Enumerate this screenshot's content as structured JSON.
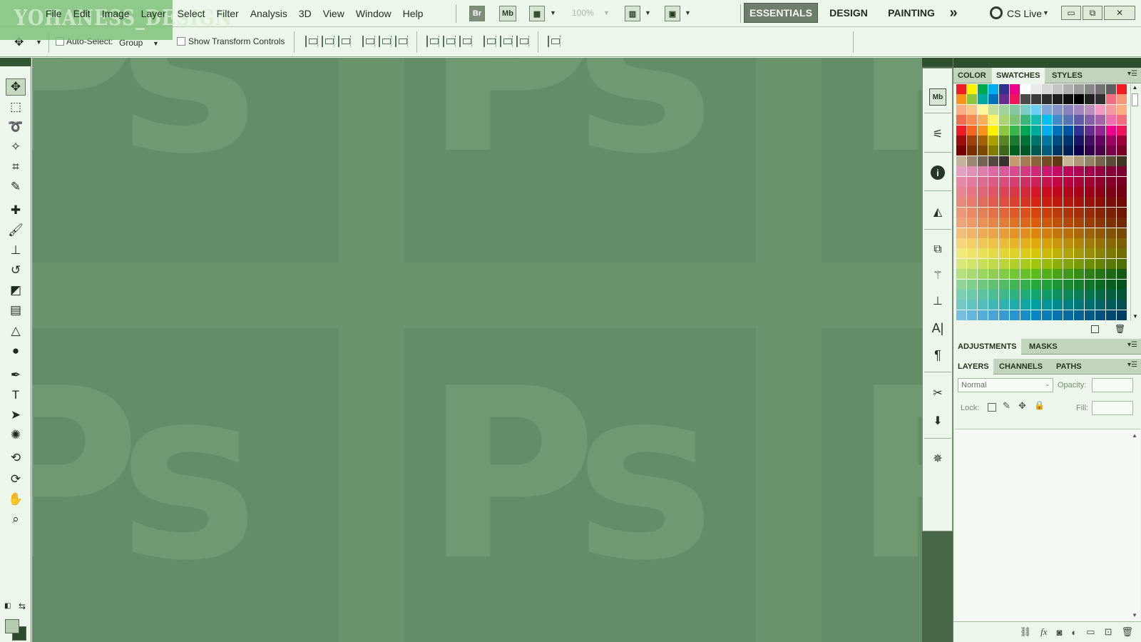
{
  "app": {
    "watermark": "YOHANESS_DESIGN",
    "menus": [
      "File",
      "Edit",
      "Image",
      "Layer",
      "Select",
      "Filter",
      "Analysis",
      "3D",
      "View",
      "Window",
      "Help"
    ],
    "bridge_label": "Br",
    "minibridge_label": "Mb",
    "zoom": "100%",
    "workspaces": [
      "ESSENTIALS",
      "DESIGN",
      "PAINTING"
    ],
    "more_workspaces": "»",
    "cs_live": "CS Live",
    "window_buttons": [
      "▭",
      "⧉",
      "✕"
    ]
  },
  "options": {
    "auto_select_label": "Auto-Select:",
    "auto_select_value": "Group",
    "show_transform_label": "Show Transform Controls"
  },
  "tools": [
    {
      "name": "move-tool",
      "glyph": "✥"
    },
    {
      "name": "marquee-tool",
      "glyph": "⬚"
    },
    {
      "name": "lasso-tool",
      "glyph": "➰"
    },
    {
      "name": "quick-select-tool",
      "glyph": "✧"
    },
    {
      "name": "crop-tool",
      "glyph": "⌗"
    },
    {
      "name": "eyedropper-tool",
      "glyph": "✎"
    },
    {
      "name": "healing-brush-tool",
      "glyph": "✚"
    },
    {
      "name": "brush-tool",
      "glyph": "🖌"
    },
    {
      "name": "clone-stamp-tool",
      "glyph": "⊥"
    },
    {
      "name": "history-brush-tool",
      "glyph": "↺"
    },
    {
      "name": "eraser-tool",
      "glyph": "◩"
    },
    {
      "name": "gradient-tool",
      "glyph": "▤"
    },
    {
      "name": "blur-tool",
      "glyph": "△"
    },
    {
      "name": "dodge-tool",
      "glyph": "●"
    },
    {
      "name": "pen-tool",
      "glyph": "✒"
    },
    {
      "name": "type-tool",
      "glyph": "T"
    },
    {
      "name": "path-select-tool",
      "glyph": "➤"
    },
    {
      "name": "custom-shape-tool",
      "glyph": "✺"
    },
    {
      "name": "3d-rotate-tool",
      "glyph": "⟲"
    },
    {
      "name": "3d-orbit-tool",
      "glyph": "⟳"
    },
    {
      "name": "hand-tool",
      "glyph": "✋"
    },
    {
      "name": "zoom-tool",
      "glyph": "⌕"
    }
  ],
  "canvas": {
    "ps_text": "Ps"
  },
  "dock": {
    "minibridge_label": "Mb"
  },
  "panels": {
    "top_tabs": [
      "COLOR",
      "SWATCHES",
      "STYLES"
    ],
    "adj_tabs": [
      "ADJUSTMENTS",
      "MASKS"
    ],
    "layer_tabs": [
      "LAYERS",
      "CHANNELS",
      "PATHS"
    ],
    "blend_mode": "Normal",
    "opacity_label": "Opacity:",
    "lock_label": "Lock:",
    "fill_label": "Fill:"
  },
  "colors": {
    "swatch_rows": [
      [
        "#ee1b24",
        "#fff200",
        "#00a650",
        "#00aeef",
        "#2e3192",
        "#ec008c",
        "#ffffff",
        "#ebebeb",
        "#d7d7d7",
        "#c3c3c3",
        "#afafaf",
        "#9b9b9b",
        "#878787",
        "#737373",
        "#5f5f5f",
        "#ee1b24"
      ],
      [
        "#f7941d",
        "#8dc63f",
        "#00a99d",
        "#0072bc",
        "#662d91",
        "#ed145b",
        "#4b4b4b",
        "#3c3c3c",
        "#2d2d2d",
        "#1e1e1e",
        "#0f0f0f",
        "#000000",
        "#202020",
        "#303030",
        "#f26d7d",
        "#f7977a"
      ],
      [
        "#f9ad81",
        "#fdc689",
        "#fff799",
        "#c4df9b",
        "#a3d39c",
        "#82ca9d",
        "#7bcdc8",
        "#6ecff6",
        "#7ea7d8",
        "#8493ca",
        "#8882be",
        "#a187be",
        "#bc8dbf",
        "#f49ac2",
        "#f6989d",
        "#f9ad81"
      ],
      [
        "#f26c4f",
        "#f68e56",
        "#fbaf5c",
        "#fff467",
        "#acd372",
        "#7cc576",
        "#3bb878",
        "#1abbb4",
        "#00bff3",
        "#438ccb",
        "#5574b9",
        "#605ca8",
        "#855fa8",
        "#a763a8",
        "#f06ea9",
        "#f26d7d"
      ],
      [
        "#ed1c24",
        "#f26522",
        "#f7941d",
        "#fff200",
        "#8dc63f",
        "#39b54a",
        "#00a651",
        "#00a99d",
        "#00aeef",
        "#0072bc",
        "#0054a6",
        "#2e3192",
        "#662d91",
        "#92278f",
        "#ec008c",
        "#ed145b"
      ],
      [
        "#9e0b0f",
        "#a0410d",
        "#a36209",
        "#aba000",
        "#598527",
        "#1a7b30",
        "#007236",
        "#00746b",
        "#0076a3",
        "#004b80",
        "#003471",
        "#1b1464",
        "#440e62",
        "#630460",
        "#9e005d",
        "#9e0039"
      ],
      [
        "#790000",
        "#7b2e00",
        "#7d4900",
        "#827b00",
        "#406618",
        "#005e20",
        "#005826",
        "#005952",
        "#005b7f",
        "#003663",
        "#002157",
        "#0d004c",
        "#32004b",
        "#4b0049",
        "#7b0046",
        "#7a0026"
      ],
      [
        "#c7b299",
        "#998675",
        "#736357",
        "#534741",
        "#37302d",
        "#c69c6d",
        "#a67c52",
        "#8c6239",
        "#754c24",
        "#603913",
        "#c8b596",
        "#ad9778",
        "#918367",
        "#76644d",
        "#5a4b38",
        "#3e3424"
      ],
      [
        "#e7a0c0",
        "#e48fb6",
        "#e27cad",
        "#df6aa3",
        "#db5a98",
        "#d74a8d",
        "#d33a82",
        "#cf2a77",
        "#cb1a6d",
        "#c70a62",
        "#bb0659",
        "#ae0451",
        "#a10248",
        "#95013f",
        "#880037",
        "#7c002f"
      ],
      [
        "#e88aa7",
        "#e47a9c",
        "#e06b91",
        "#dc5c86",
        "#d84d7b",
        "#d43e70",
        "#d02f65",
        "#cc215a",
        "#c8134f",
        "#c40544",
        "#b8033e",
        "#ab0238",
        "#9f0133",
        "#93012d",
        "#860027",
        "#7a0021"
      ],
      [
        "#e78592",
        "#e47583",
        "#e16574",
        "#de5565",
        "#db4656",
        "#d83747",
        "#d52838",
        "#d21929",
        "#ce0b1a",
        "#c1071a",
        "#b40419",
        "#a70218",
        "#9a0116",
        "#8d0115",
        "#800013",
        "#730012"
      ],
      [
        "#e9897d",
        "#e67a6d",
        "#e36b5d",
        "#e05d4e",
        "#dd4e3f",
        "#da4030",
        "#d73222",
        "#d42414",
        "#cc1d0f",
        "#bf190e",
        "#b2160d",
        "#a5130c",
        "#98100a",
        "#8b0e09",
        "#7e0c08",
        "#710a07"
      ],
      [
        "#ec977a",
        "#e98a69",
        "#e67e59",
        "#e37249",
        "#e0663a",
        "#dd5a2b",
        "#da4f1c",
        "#d7440e",
        "#cb3e0c",
        "#be390b",
        "#b1330a",
        "#a42e09",
        "#972908",
        "#8a2407",
        "#7d1f06",
        "#701a05"
      ],
      [
        "#efa57a",
        "#ec9a69",
        "#e98f58",
        "#e68548",
        "#e37b39",
        "#e0712a",
        "#dd671c",
        "#da5e0e",
        "#ce570c",
        "#c1500b",
        "#b4490a",
        "#a74209",
        "#9a3c08",
        "#8d3507",
        "#802f06",
        "#732905"
      ],
      [
        "#f3bd7a",
        "#f0b469",
        "#edab58",
        "#eaa348",
        "#e79b39",
        "#e4932a",
        "#e18c1c",
        "#de850e",
        "#d27d0c",
        "#c5760b",
        "#b86f0a",
        "#ab6709",
        "#9e6008",
        "#915907",
        "#845206",
        "#774b05"
      ],
      [
        "#f7d57a",
        "#f4ce69",
        "#f1c858",
        "#eec148",
        "#ebbb39",
        "#e8b52a",
        "#e5af1c",
        "#e2a90e",
        "#d6a00c",
        "#c9970b",
        "#bc8d0a",
        "#af8409",
        "#a27a08",
        "#957107",
        "#886806",
        "#7b5f05"
      ],
      [
        "#f3e97a",
        "#efe469",
        "#ebdf58",
        "#e7da48",
        "#e3d539",
        "#dfd02a",
        "#dbcb1c",
        "#d7c60e",
        "#cbba0c",
        "#beaf0b",
        "#b1a40a",
        "#a49909",
        "#978e08",
        "#8a8307",
        "#7d7806",
        "#706d05"
      ],
      [
        "#d9e87a",
        "#d1e369",
        "#c9df58",
        "#c1da48",
        "#b9d539",
        "#b1d02a",
        "#a9cb1c",
        "#a1c60e",
        "#97ba0c",
        "#8daf0b",
        "#83a40a",
        "#799909",
        "#6f8e08",
        "#658307",
        "#5b7806",
        "#516d05"
      ],
      [
        "#b6df80",
        "#a9da71",
        "#9cd562",
        "#8fd053",
        "#82cb45",
        "#75c637",
        "#68c129",
        "#5bbc1b",
        "#52b01a",
        "#49a419",
        "#409818",
        "#378c17",
        "#2e8016",
        "#257415",
        "#1c6814",
        "#135c13"
      ],
      [
        "#90d49a",
        "#80ce8c",
        "#70c87e",
        "#60c270",
        "#51bc63",
        "#42b656",
        "#33b049",
        "#24aa3c",
        "#20a038",
        "#1c9534",
        "#188a30",
        "#147f2c",
        "#107428",
        "#0c6924",
        "#085e20",
        "#04531c"
      ],
      [
        "#7dcfb3",
        "#6dc9a9",
        "#5dc39f",
        "#4dbd95",
        "#3eb78b",
        "#2fb182",
        "#20ab78",
        "#11a56f",
        "#0f9b68",
        "#0d9161",
        "#0b875a",
        "#097d53",
        "#07734c",
        "#056945",
        "#035f3e",
        "#015537"
      ],
      [
        "#74c9c8",
        "#63c3c2",
        "#52bdbc",
        "#41b7b6",
        "#31b1b0",
        "#21abab",
        "#11a5a5",
        "#019fa0",
        "#019596",
        "#018b8c",
        "#018182",
        "#017778",
        "#016d6e",
        "#016364",
        "#01595a",
        "#014f50"
      ],
      [
        "#76bde0",
        "#66b5dc",
        "#56add8",
        "#46a5d4",
        "#379dd0",
        "#2895cc",
        "#198dc8",
        "#0a85c4",
        "#097cb8",
        "#0873ac",
        "#076aa0",
        "#066194",
        "#055888",
        "#044f7c",
        "#034670",
        "#023d64"
      ]
    ]
  }
}
